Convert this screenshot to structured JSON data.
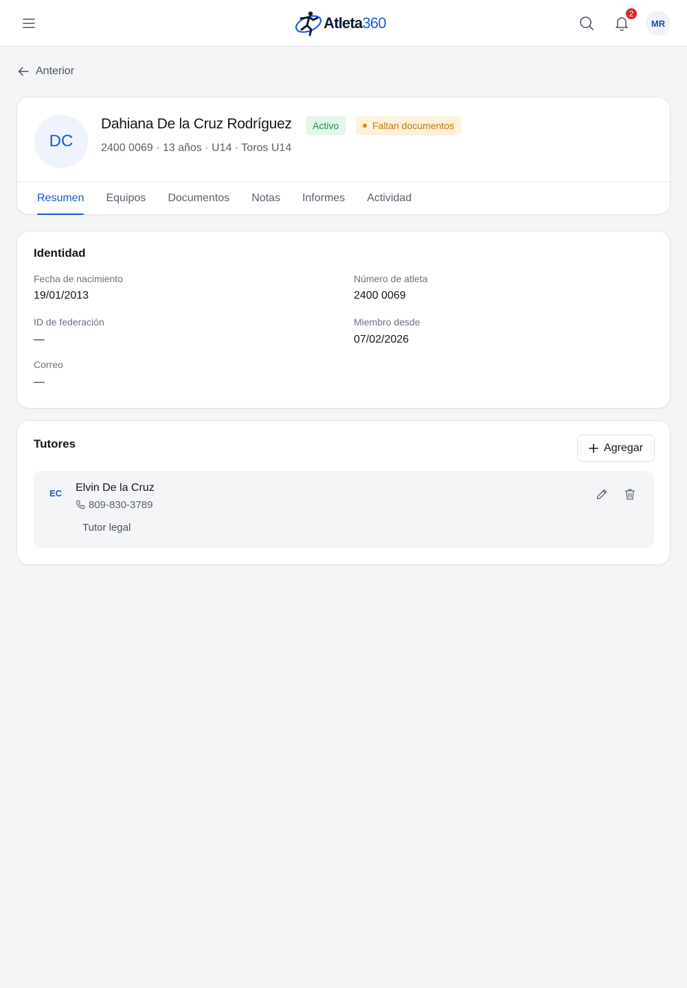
{
  "header": {
    "logo_text": "Atleta",
    "logo_number": "360",
    "notification_count": "2",
    "user_initials": "MR",
    "icons": {
      "menu": "menu-icon",
      "search": "search-icon",
      "notifications": "bell-icon"
    }
  },
  "back": {
    "label": "Anterior",
    "icon": "arrow-left-icon"
  },
  "profile": {
    "initials": "DC",
    "name": "Dahiana De la Cruz Rodríguez",
    "status_badge": "Activo",
    "warning_badge": "Faltan documentos",
    "meta": "2400 0069 · 13 años · U14 · Toros U14"
  },
  "tabs": [
    {
      "label": "Resumen",
      "active": true
    },
    {
      "label": "Equipos",
      "active": false
    },
    {
      "label": "Documentos",
      "active": false
    },
    {
      "label": "Notas",
      "active": false
    },
    {
      "label": "Informes",
      "active": false
    },
    {
      "label": "Actividad",
      "active": false
    }
  ],
  "identity": {
    "title": "Identidad",
    "fields": {
      "birth_date": {
        "label": "Fecha de nacimiento",
        "value": "19/01/2013"
      },
      "athlete_number": {
        "label": "Número de atleta",
        "value": "2400 0069"
      },
      "federation_id": {
        "label": "ID de federación",
        "value": "—"
      },
      "member_since": {
        "label": "Miembro desde",
        "value": "07/02/2026"
      },
      "email": {
        "label": "Correo",
        "value": "—"
      }
    }
  },
  "tutors": {
    "title": "Tutores",
    "add_label": "Agregar",
    "items": [
      {
        "initials": "EC",
        "name": "Elvin De la Cruz",
        "phone": "809-830-3789",
        "role": "Tutor legal"
      }
    ]
  },
  "colors": {
    "accent": "#1d57c9",
    "active_badge_bg": "#e3f6ea",
    "active_badge_text": "#1b8a45",
    "warning_badge_bg": "#fdf1d9",
    "warning_badge_text": "#c47a06",
    "notification_badge": "#d7262e",
    "page_bg": "#f4f5f7"
  }
}
